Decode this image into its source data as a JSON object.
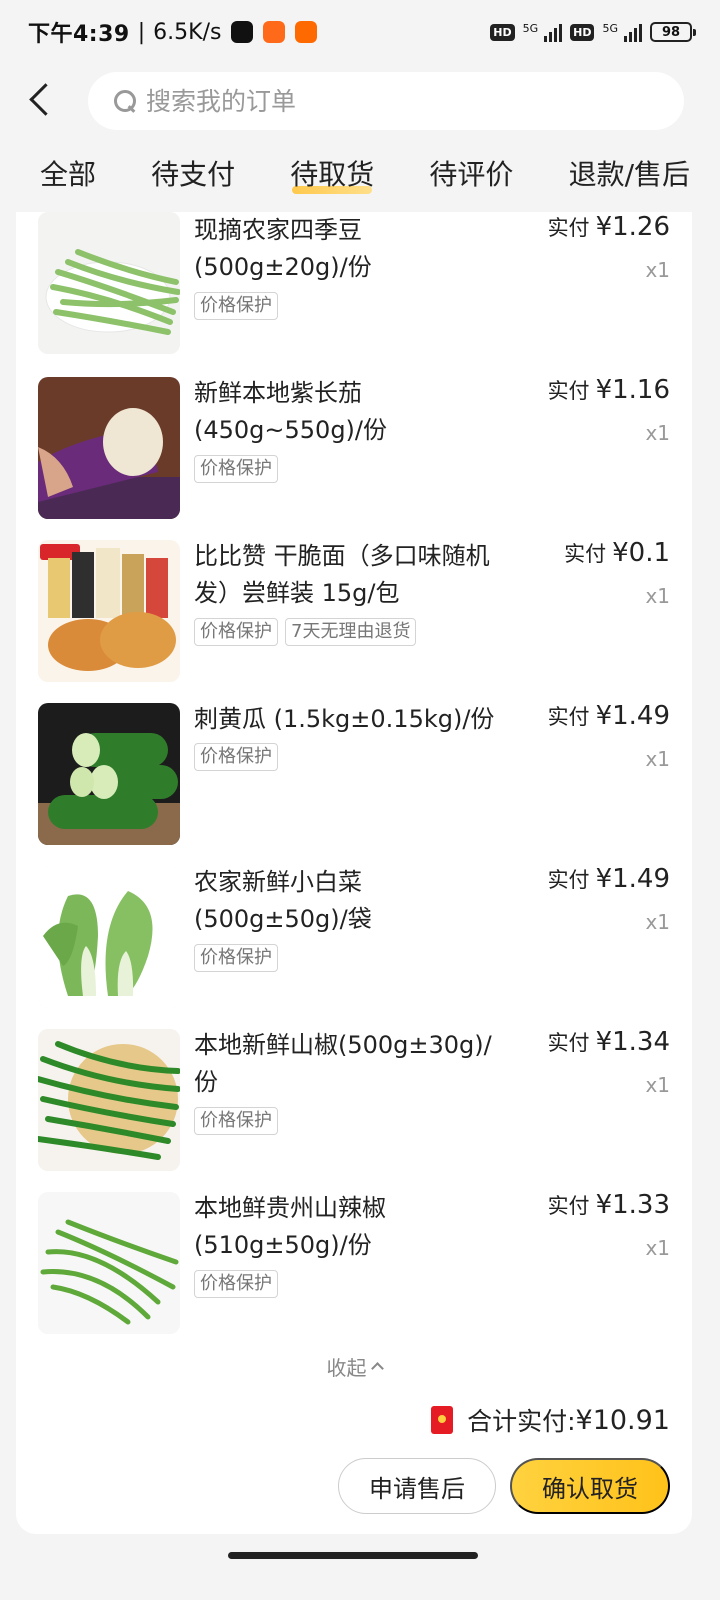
{
  "status_bar": {
    "time": "下午4:39",
    "net_speed": "6.5K/s",
    "hd1": "HD",
    "net1": "5G",
    "hd2": "HD",
    "net2": "5G",
    "battery": "98"
  },
  "search": {
    "placeholder": "搜索我的订单"
  },
  "tabs": [
    {
      "label": "全部",
      "active": false
    },
    {
      "label": "待支付",
      "active": false
    },
    {
      "label": "待取货",
      "active": true
    },
    {
      "label": "待评价",
      "active": false
    },
    {
      "label": "退款/售后",
      "active": false
    }
  ],
  "price_label": "实付",
  "items": [
    {
      "title": "现摘农家四季豆(500g±20g)/份",
      "price": "¥1.26",
      "qty": "x1",
      "tags": [
        "价格保护"
      ]
    },
    {
      "title": "新鲜本地紫长茄(450g~550g)/份",
      "price": "¥1.16",
      "qty": "x1",
      "tags": [
        "价格保护"
      ]
    },
    {
      "title": "比比赞 干脆面（多口味随机发）尝鲜装 15g/包",
      "price": "¥0.1",
      "qty": "x1",
      "tags": [
        "价格保护",
        "7天无理由退货"
      ]
    },
    {
      "title": "刺黄瓜 (1.5kg±0.15kg)/份",
      "price": "¥1.49",
      "qty": "x1",
      "tags": [
        "价格保护"
      ]
    },
    {
      "title": "农家新鲜小白菜(500g±50g)/袋",
      "price": "¥1.49",
      "qty": "x1",
      "tags": [
        "价格保护"
      ]
    },
    {
      "title": "本地新鲜山椒(500g±30g)/份",
      "price": "¥1.34",
      "qty": "x1",
      "tags": [
        "价格保护"
      ]
    },
    {
      "title": "本地鲜贵州山辣椒(510g±50g)/份",
      "price": "¥1.33",
      "qty": "x1",
      "tags": [
        "价格保护"
      ]
    }
  ],
  "collapse_label": "收起",
  "total": {
    "label": "合计实付:",
    "amount": "¥10.91"
  },
  "buttons": {
    "after_sale": "申请售后",
    "confirm": "确认取货"
  },
  "colors": {
    "accent": "#ffc94d",
    "background": "#f4f4f4",
    "red_icon": "#e51c23"
  }
}
